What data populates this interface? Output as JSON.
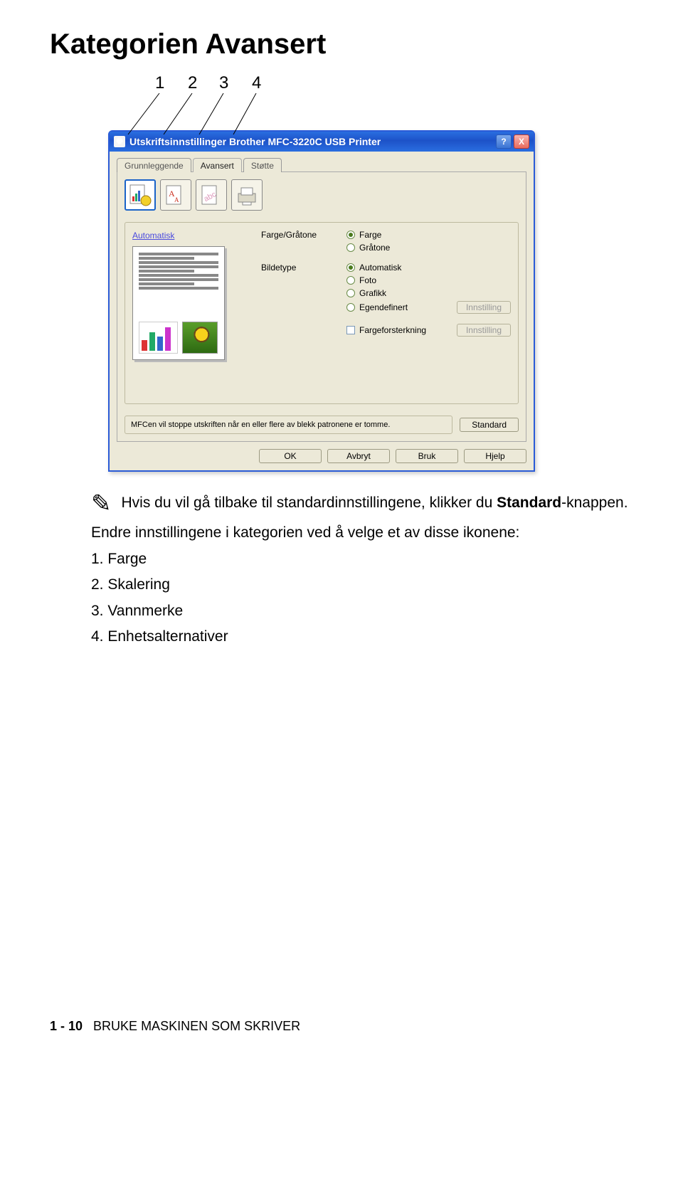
{
  "heading": "Kategorien Avansert",
  "callout_numbers": [
    "1",
    "2",
    "3",
    "4"
  ],
  "dialog": {
    "title": "Utskriftsinnstillinger Brother MFC-3220C USB Printer",
    "help_label": "?",
    "close_label": "X",
    "tabs": {
      "grunnleggende": "Grunnleggende",
      "avansert": "Avansert",
      "stotte": "Støtte"
    },
    "preview_label": "Automatisk",
    "labels": {
      "farge_gratone": "Farge/Gråtone",
      "farge": "Farge",
      "gratone": "Gråtone",
      "bildetype": "Bildetype",
      "automatisk": "Automatisk",
      "foto": "Foto",
      "grafikk": "Grafikk",
      "egendefinert": "Egendefinert",
      "innstilling": "Innstilling",
      "fargeforsterkning": "Fargeforsterkning"
    },
    "info_text": "MFCen vil stoppe utskriften når en eller flere av blekk patronene er tomme.",
    "standard_btn": "Standard",
    "buttons": {
      "ok": "OK",
      "avbryt": "Avbryt",
      "bruk": "Bruk",
      "hjelp": "Hjelp"
    }
  },
  "note_text": "Hvis du vil gå tilbake til standardinnstillingene, klikker du ",
  "note_bold": "Standard",
  "note_tail": "-knappen.",
  "intro": "Endre innstillingene i kategorien ved å velge et av disse ikonene:",
  "list": {
    "l1": "1. Farge",
    "l2": "2. Skalering",
    "l3": "3. Vannmerke",
    "l4": "4. Enhetsalternativer"
  },
  "footer": {
    "page": "1 - 10",
    "section": "BRUKE MASKINEN SOM SKRIVER"
  }
}
